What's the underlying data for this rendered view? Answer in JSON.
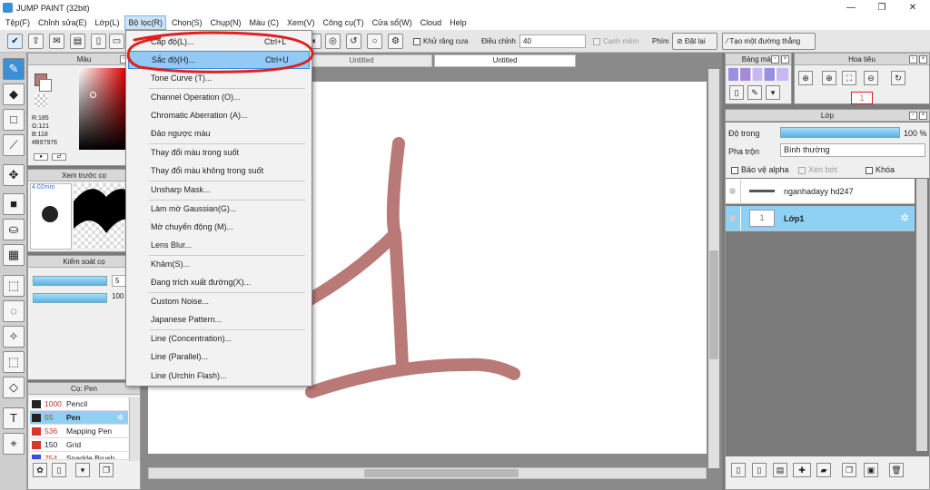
{
  "window": {
    "title": "JUMP PAINT (32bit)",
    "minimize": "—",
    "restore": "❐",
    "close": "✕"
  },
  "menu": [
    {
      "label": "Tệp(F)"
    },
    {
      "label": "Chỉnh sửa(E)"
    },
    {
      "label": "Lớp(L)"
    },
    {
      "label": "Bộ lọc(R)"
    },
    {
      "label": "Chọn(S)"
    },
    {
      "label": "Chụp(N)"
    },
    {
      "label": "Màu (C)"
    },
    {
      "label": "Xem(V)"
    },
    {
      "label": "Công cụ(T)"
    },
    {
      "label": "Cửa sổ(W)"
    },
    {
      "label": "Cloud"
    },
    {
      "label": "Help"
    }
  ],
  "toolbar": {
    "antialias": "Khử răng cưa",
    "adjust_label": "Điều chỉnh",
    "adjust_value": "40",
    "smooth": "Cạnh mềm",
    "keys": "Phím",
    "reset": "Đặt lại",
    "straight_line": "Tạo một đường thẳng"
  },
  "filter_menu": {
    "items": [
      {
        "label": "Cấp độ(L)...",
        "shortcut": "Ctrl+L"
      },
      {
        "label": "Sắc độ(H)...",
        "shortcut": "Ctrl+U"
      },
      {
        "label": "Tone Curve (T)...",
        "shortcut": ""
      },
      {
        "label": "Channel Operation (O)...",
        "shortcut": ""
      },
      {
        "label": "Chromatic Aberration (A)...",
        "shortcut": ""
      },
      {
        "label": "Đảo ngược màu",
        "shortcut": ""
      },
      {
        "label": "Thay đổi màu trong suốt",
        "shortcut": ""
      },
      {
        "label": "Thay đổi màu không trong suốt",
        "shortcut": ""
      },
      {
        "label": "Unsharp Mask...",
        "shortcut": ""
      },
      {
        "label": "Làm mờ Gaussian(G)...",
        "shortcut": ""
      },
      {
        "label": "Mờ chuyển động (M)...",
        "shortcut": ""
      },
      {
        "label": "Lens Blur...",
        "shortcut": ""
      },
      {
        "label": "Khảm(S)...",
        "shortcut": ""
      },
      {
        "label": "Đang trích xuất đường(X)...",
        "shortcut": ""
      },
      {
        "label": "Custom Noise...",
        "shortcut": ""
      },
      {
        "label": "Japanese Pattern...",
        "shortcut": ""
      },
      {
        "label": "Line (Concentration)...",
        "shortcut": ""
      },
      {
        "label": "Line (Parallel)...",
        "shortcut": ""
      },
      {
        "label": "Line (Urchin Flash)...",
        "shortcut": ""
      }
    ],
    "highlighted_index": 1
  },
  "color_panel": {
    "title": "Màu",
    "r": "R:185",
    "g": "G:121",
    "b": "B:118",
    "hex": "#B97976",
    "main_color": "#b97976"
  },
  "brush_preview": {
    "title": "Xem trước cọ",
    "size": "4.02mm"
  },
  "brush_control": {
    "title": "Kiểm soát cọ",
    "value1": "5",
    "value2": "100"
  },
  "brushes": {
    "title": "Cọ: Pen",
    "items": [
      {
        "size": "1000",
        "name": "Pencil",
        "color": "#222222"
      },
      {
        "size": "55",
        "name": "Pen",
        "color": "#222222"
      },
      {
        "size": "536",
        "name": "Mapping Pen",
        "color": "#d43a2e"
      },
      {
        "size": "150",
        "name": "Grid",
        "color": "#d43a2e"
      },
      {
        "size": "754",
        "name": "Sparkle Brush",
        "color": "#3a4fd4"
      }
    ],
    "selected_index": 1
  },
  "tabs": [
    {
      "label": "Untitled"
    },
    {
      "label": "Untitled"
    }
  ],
  "palette_panel": {
    "title": "Bảng màu"
  },
  "navigator_panel": {
    "title": "Hoa tiêu"
  },
  "layer_panel": {
    "title": "Lớp",
    "opacity_label": "Độ trong",
    "opacity_value": "100 %",
    "blend_label": "Pha trộn",
    "blend_value": "Bình thường",
    "protect_alpha": "Bảo vệ alpha",
    "clipping": "Xén bớt",
    "lock": "Khóa",
    "layers": [
      {
        "name": "nganhadayy hd247"
      },
      {
        "name": "Lớp1"
      }
    ],
    "selected_index": 1
  },
  "colors": {
    "accent": "#3a8fd8",
    "highlight": "#91c9f7",
    "stroke": "#b97976",
    "annotation": "#e02020"
  }
}
